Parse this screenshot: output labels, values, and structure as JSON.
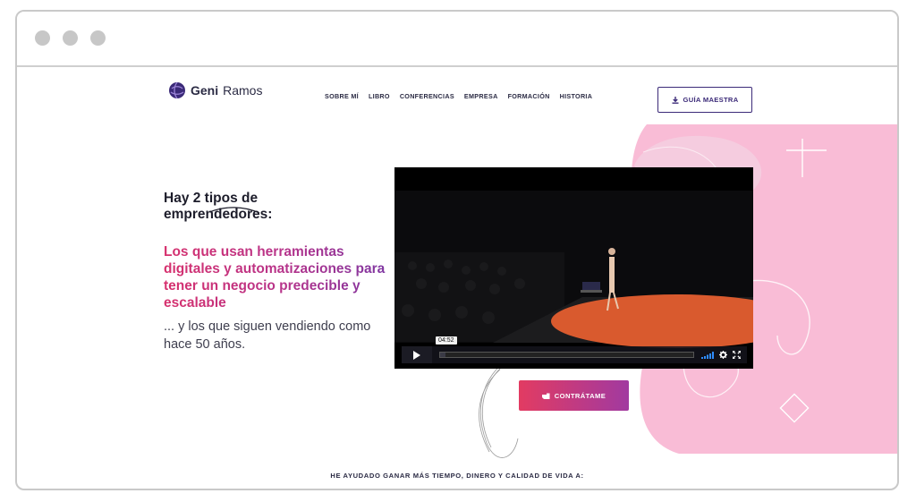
{
  "brand": {
    "name_bold": "Geni",
    "name_regular": "Ramos"
  },
  "nav": {
    "items": [
      "SOBRE MÍ",
      "LIBRO",
      "CONFERENCIAS",
      "EMPRESA",
      "FORMACIÓN",
      "HISTORIA"
    ]
  },
  "header_cta": {
    "label": "GUÍA MAESTRA",
    "icon": "download-icon"
  },
  "hero": {
    "title": "Hay 2 tipos de emprendedores:",
    "highlight": "Los que usan herramientas digitales y automatizaciones para tener un negocio predecible y escalable",
    "subtitle": "... y los que siguen vendiendo como hace 50 años."
  },
  "video": {
    "time": "04:52",
    "progress": 0.02,
    "icons": [
      "play-icon",
      "volume-icon",
      "settings-icon",
      "fullscreen-icon"
    ]
  },
  "hire_cta": {
    "label": "CONTRÁTAME",
    "icon": "hand-pointer-icon"
  },
  "bottom": {
    "text": "HE AYUDADO GANAR MÁS TIEMPO, DINERO Y CALIDAD DE VIDA A:"
  },
  "colors": {
    "accent_purple": "#3b2a78",
    "pink_bg": "#f9bcd6",
    "gradient_start": "#e23b62",
    "gradient_end": "#a13aa0"
  }
}
